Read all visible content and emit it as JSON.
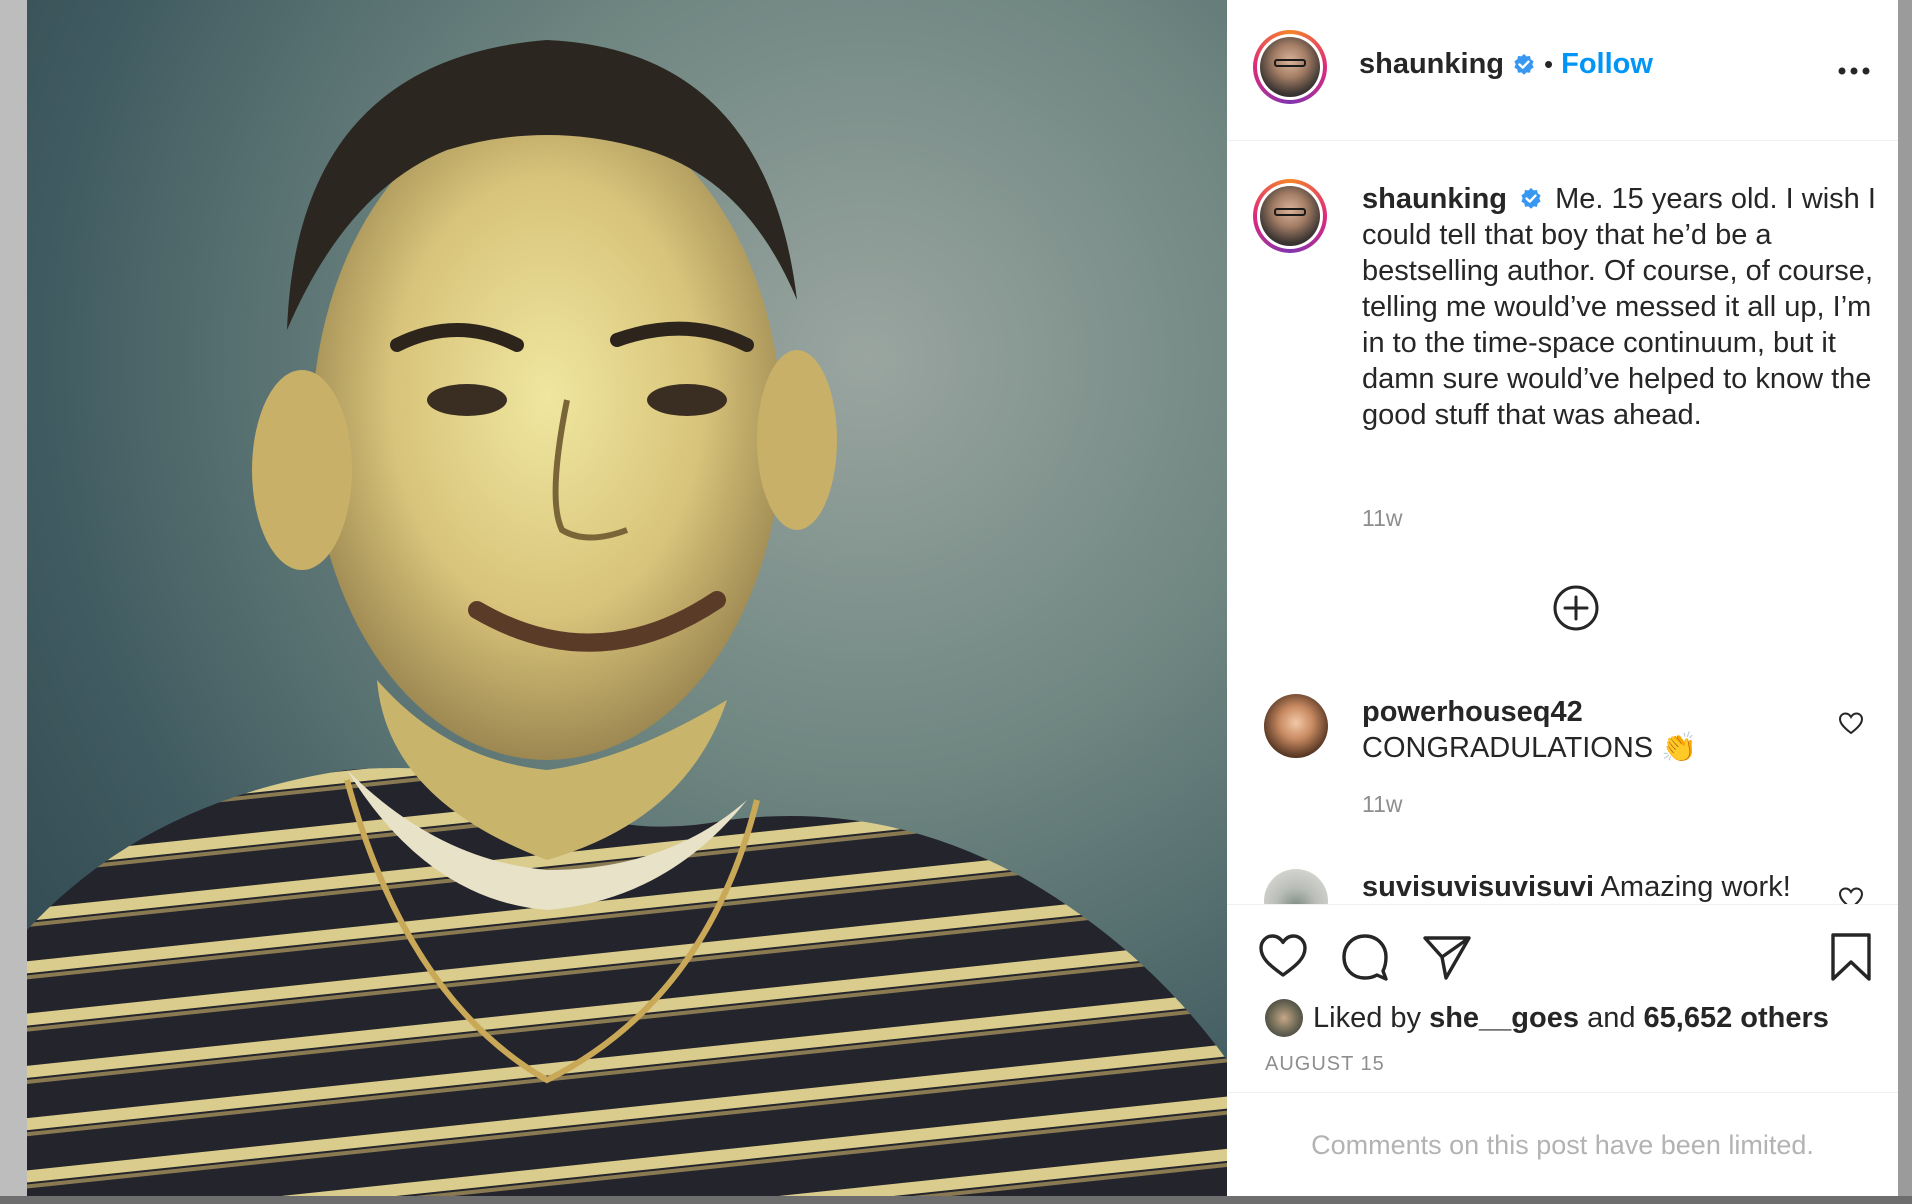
{
  "post": {
    "author": "shaunking",
    "follow_label": "Follow",
    "separator": "•",
    "caption_username": "shaunking",
    "caption": "Me. 15 years old. I wish I could tell that boy that he’d be a bestselling author. Of course, of course, telling me would’ve messed it all up, I’m in to the time-space continuum, but it damn sure would’ve helped to know the good stuff that was ahead.",
    "caption_time": "11w"
  },
  "comments": [
    {
      "username": "powerhouseq42",
      "text": "CONGRADULATIONS 👏",
      "time": "11w"
    },
    {
      "username": "suvisuvisuvisuvi",
      "text": "Amazing work!"
    }
  ],
  "likes": {
    "prefix": "Liked by",
    "user": "she__goes",
    "middle": "and",
    "count_text": "65,652 others"
  },
  "date": "AUGUST 15",
  "limited_text": "Comments on this post have been limited.",
  "colors": {
    "accent": "#0095f6",
    "text": "#262626",
    "muted": "#8e8e8e",
    "verified": "#3897f0"
  },
  "icons": [
    "verified-icon",
    "more-icon",
    "plus-circle-icon",
    "heart-icon",
    "comment-icon",
    "share-icon",
    "bookmark-icon"
  ]
}
